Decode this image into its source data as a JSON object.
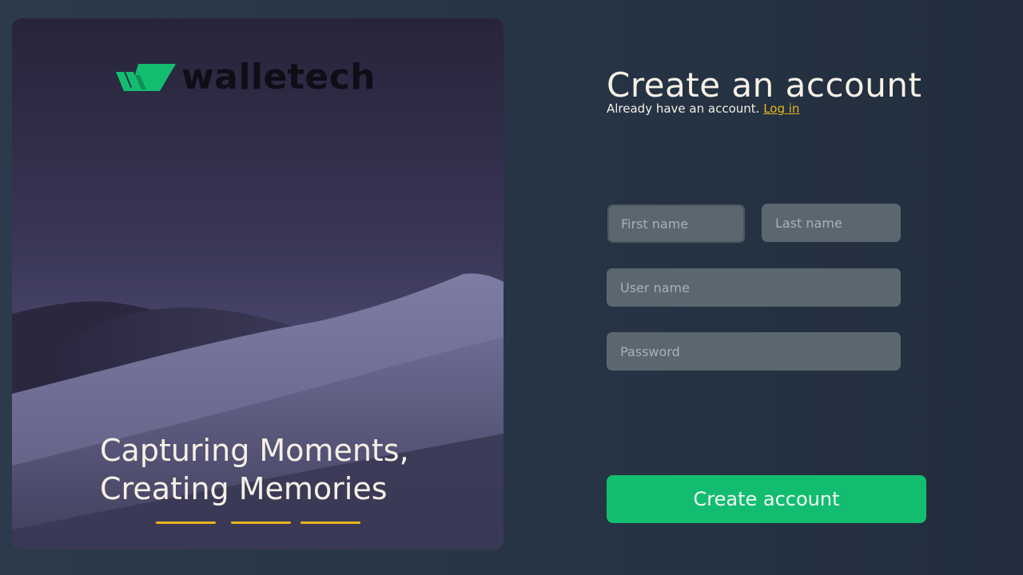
{
  "brand": {
    "name": "walletech",
    "logo_icon": "walletech-logo-mark",
    "accent_color": "#13bd70"
  },
  "hero": {
    "tagline_line1": "Capturing Moments,",
    "tagline_line2": "Creating Memories",
    "carousel_count": 3,
    "indicator_color": "#e9b51f"
  },
  "form": {
    "title": "Create an account",
    "subtitle_prefix": "Already have an account.",
    "login_link": "Log in",
    "first_name": {
      "placeholder": "First name",
      "value": ""
    },
    "last_name": {
      "placeholder": "Last name",
      "value": ""
    },
    "user_name": {
      "placeholder": "User name",
      "value": ""
    },
    "password": {
      "placeholder": "Password",
      "value": ""
    },
    "submit_label": "Create account"
  }
}
